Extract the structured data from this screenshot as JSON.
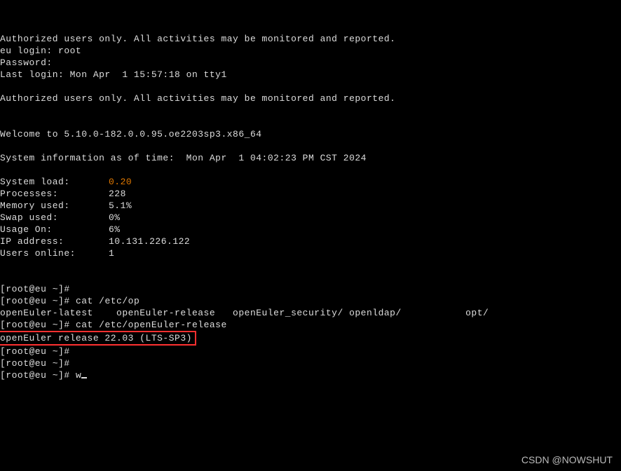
{
  "banner1": "Authorized users only. All activities may be monitored and reported.",
  "login_prompt": "eu login: root",
  "password_prompt": "Password:",
  "last_login": "Last login: Mon Apr  1 15:57:18 on tty1",
  "banner2": "Authorized users only. All activities may be monitored and reported.",
  "welcome": "Welcome to 5.10.0-182.0.0.95.oe2203sp3.x86_64",
  "sysinfo_header": "System information as of time:  Mon Apr  1 04:02:23 PM CST 2024",
  "info": {
    "system_load_label": "System load:",
    "system_load_value": "0.20",
    "processes_label": "Processes:",
    "processes_value": "228",
    "memory_label": "Memory used:",
    "memory_value": "5.1%",
    "swap_label": "Swap used:",
    "swap_value": "0%",
    "usage_label": "Usage On:",
    "usage_value": "6%",
    "ip_label": "IP address:",
    "ip_value": "10.131.226.122",
    "users_label": "Users online:",
    "users_value": "1"
  },
  "ps1": "[root@eu ~]#",
  "cmd1": "cat /etc/op",
  "completions": "openEuler-latest    openEuler-release   openEuler_security/ openldap/           opt/",
  "cmd2": "cat /etc/openEuler-release",
  "release": "openEuler release 22.03 (LTS-SP3)",
  "cmd3": "w",
  "watermark": "CSDN @NOWSHUT"
}
